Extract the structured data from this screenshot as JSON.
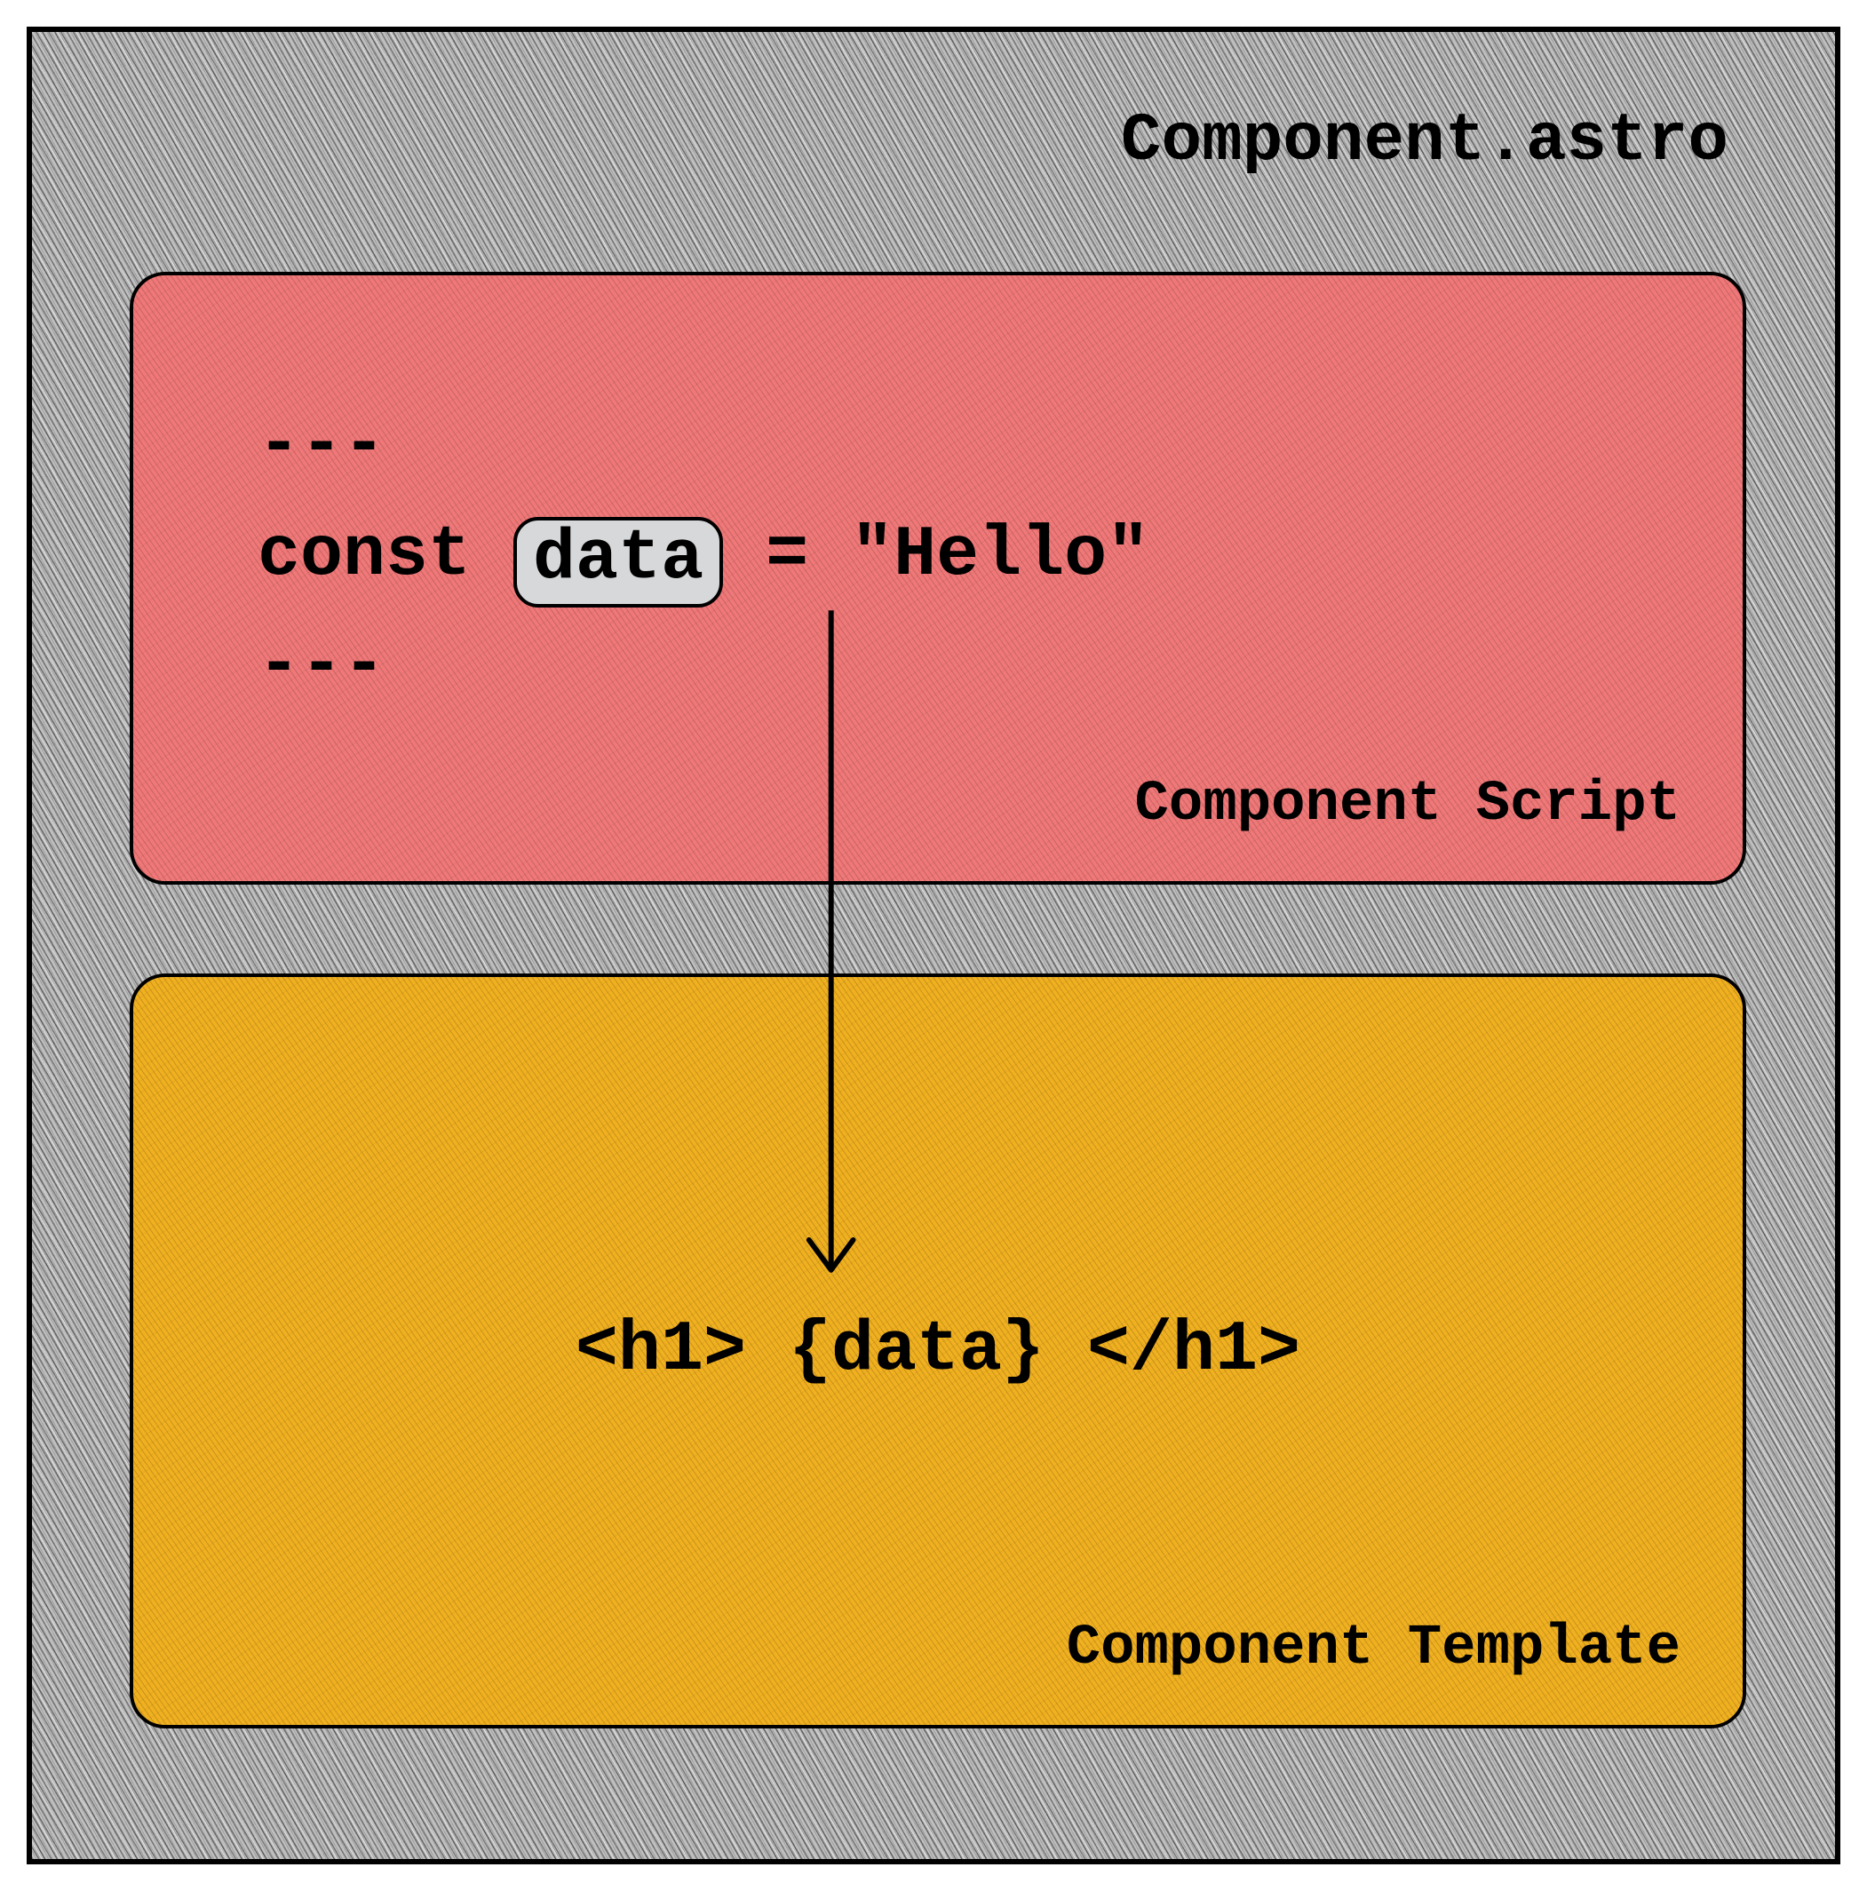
{
  "file_title": "Component.astro",
  "script_panel": {
    "label": "Component Script",
    "fence_top": "---",
    "code_prefix": "const ",
    "pill_text": "data",
    "code_suffix": " = \"Hello\"",
    "fence_bottom": "---"
  },
  "template_panel": {
    "label": "Component Template",
    "code": "<h1> {data} </h1>"
  }
}
